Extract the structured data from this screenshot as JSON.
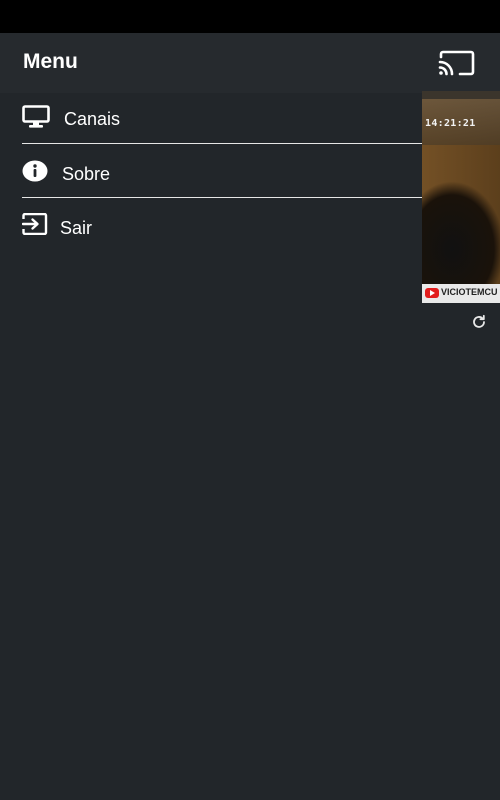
{
  "drawer": {
    "title": "Menu",
    "items": [
      {
        "label": "Canais",
        "icon": "monitor-icon"
      },
      {
        "label": "Sobre",
        "icon": "info-icon"
      },
      {
        "label": "Sair",
        "icon": "exit-icon"
      }
    ]
  },
  "video": {
    "timestamp": "14:21:21",
    "ticker": "VICIOTEMCU"
  },
  "toolbar": {
    "cast_icon": "cast-icon"
  },
  "colors": {
    "drawer_bg": "#22262a",
    "header_bg": "#262a2e",
    "divider": "#e6e6e6",
    "text": "#ffffff",
    "status_bar": "#000000"
  }
}
